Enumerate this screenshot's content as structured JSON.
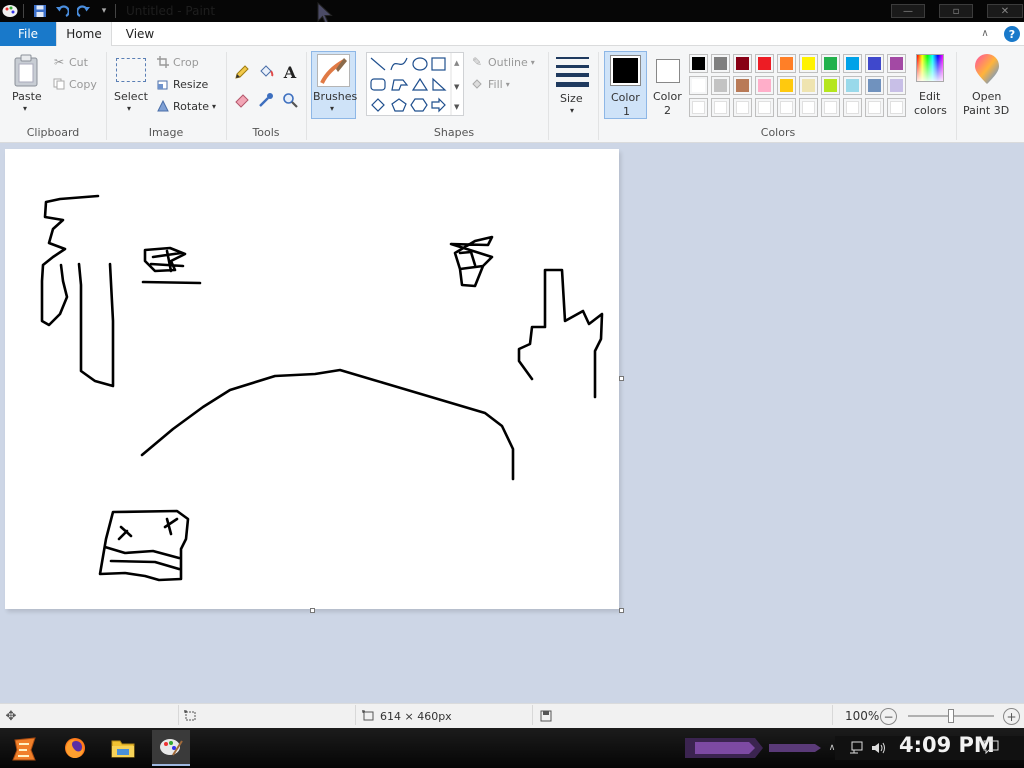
{
  "window": {
    "title": "Untitled - Paint"
  },
  "tabs": {
    "file": "File",
    "home": "Home",
    "view": "View"
  },
  "clipboard": {
    "paste": "Paste",
    "cut": "Cut",
    "copy": "Copy",
    "group": "Clipboard"
  },
  "image": {
    "select": "Select",
    "crop": "Crop",
    "resize": "Resize",
    "rotate": "Rotate",
    "group": "Image"
  },
  "tools": {
    "group": "Tools"
  },
  "brushes": {
    "label": "Brushes"
  },
  "shapes": {
    "outline": "Outline",
    "fill": "Fill",
    "group": "Shapes"
  },
  "size": {
    "label": "Size"
  },
  "colors": {
    "color1": "Color",
    "color1_num": "1",
    "color2": "Color",
    "color2_num": "2",
    "edit1": "Edit",
    "edit2": "colors",
    "group": "Colors",
    "color1_value": "#000000",
    "color2_value": "#ffffff",
    "palette": [
      "#000000",
      "#7f7f7f",
      "#880015",
      "#ed1c24",
      "#ff7f27",
      "#fff200",
      "#22b14c",
      "#00a2e8",
      "#3f48cc",
      "#a349a4",
      "#ffffff",
      "#c3c3c3",
      "#b97a57",
      "#ffaec9",
      "#ffc90e",
      "#efe4b0",
      "#b5e61d",
      "#99d9ea",
      "#7092be",
      "#c8bfe7",
      "#ffffff",
      "#ffffff",
      "#ffffff",
      "#ffffff",
      "#ffffff",
      "#ffffff",
      "#ffffff",
      "#ffffff",
      "#ffffff",
      "#ffffff"
    ]
  },
  "paint3d": {
    "line1": "Open",
    "line2": "Paint 3D"
  },
  "status": {
    "dimensions": "614 × 460px",
    "zoom": "100%",
    "zoom_percent": 100
  },
  "taskbar": {
    "time": "4:09 PM"
  }
}
